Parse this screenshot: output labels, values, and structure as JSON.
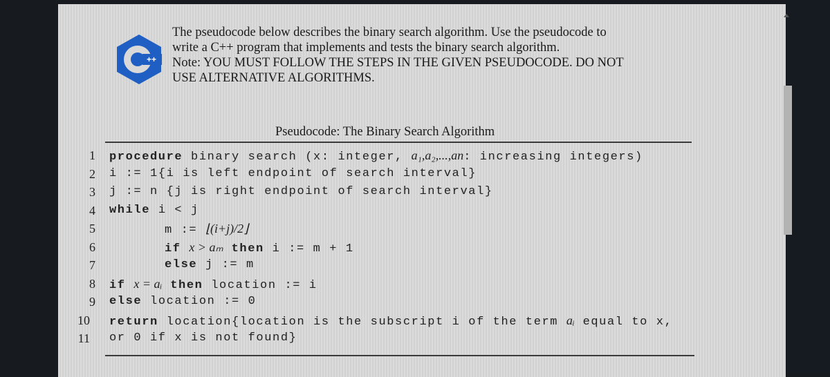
{
  "intro": {
    "lines": [
      "The pseudocode below describes the binary search algorithm. Use the pseudocode to",
      "write a C++ program that implements and tests the binary search algorithm.",
      "Note: YOU MUST FOLLOW THE STEPS IN THE GIVEN PSEUDOCODE. DO NOT",
      "USE ALTERNATIVE ALGORITHMS."
    ]
  },
  "logo": {
    "name": "C++",
    "color": "#1f5fc4"
  },
  "pseudocode": {
    "title": "Pseudocode: The Binary Search Algorithm",
    "lines": [
      {
        "n": "1",
        "kw": "procedure",
        "rest": " binary search (x: integer, ",
        "math": "a₁,a₂,...,an",
        "tail": ": increasing integers)"
      },
      {
        "n": "2",
        "kw": "",
        "rest": "i := 1{i is left endpoint of search interval}",
        "math": "",
        "tail": ""
      },
      {
        "n": "3",
        "kw": "",
        "rest": "j := n {j is right endpoint of search interval}",
        "math": "",
        "tail": ""
      },
      {
        "n": "4",
        "kw": "while",
        "rest": " i < j",
        "math": "",
        "tail": ""
      },
      {
        "n": "5",
        "kw": "",
        "rest": "m := ",
        "math": "⌊(i+j)/2⌋",
        "tail": ""
      },
      {
        "n": "6",
        "kw": "if",
        "rest": " ",
        "math": "x > aₘ",
        "tail": " then i := m + 1",
        "kw2": "then"
      },
      {
        "n": "7",
        "kw": "else",
        "rest": " j := m",
        "math": "",
        "tail": ""
      },
      {
        "n": "8",
        "kw": "if",
        "rest": " ",
        "math": "x = aᵢ",
        "tail": " then location := i"
      },
      {
        "n": "9",
        "kw": "else",
        "rest": " location := 0",
        "math": "",
        "tail": ""
      },
      {
        "n": "10",
        "kw": "return",
        "rest": " location{location is the subscript i of the term ",
        "math": "aᵢ",
        "tail": " equal to x,"
      },
      {
        "n": "11",
        "kw": "",
        "rest": "or 0 if x is not found}",
        "math": "",
        "tail": ""
      }
    ]
  }
}
